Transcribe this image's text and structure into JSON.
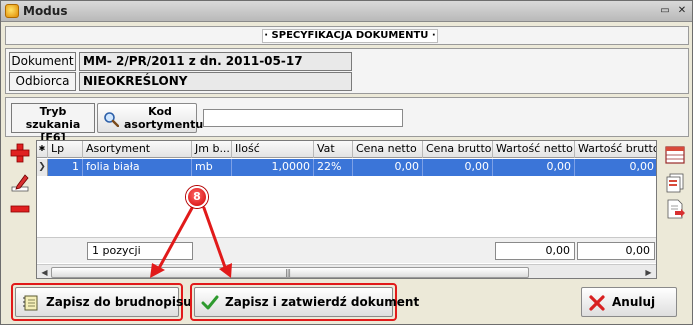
{
  "window": {
    "title": "Modus"
  },
  "section_title": "· SPECYFIKACJA DOKUMENTU ·",
  "document": {
    "label": "Dokument",
    "value": "MM- 2/PR/2011 z dn. 2011-05-17",
    "recipient_label": "Odbiorca",
    "recipient_value": "NIEOKREŚLONY"
  },
  "search": {
    "mode_line1": "Tryb szukania",
    "mode_line2": "[F6]",
    "code_button_line1": "Kod",
    "code_button_line2": "asortymentu",
    "input_value": ""
  },
  "grid": {
    "columns": [
      "Lp",
      "Asortyment",
      "Jm b...",
      "Ilość",
      "Vat",
      "Cena netto",
      "Cena brutto",
      "Wartość netto",
      "Wartość brutto"
    ],
    "rows": [
      {
        "lp": "1",
        "asortyment": "folia biała",
        "jm": "mb",
        "ilosc": "1,0000",
        "vat": "22%",
        "cena_netto": "0,00",
        "cena_brutto": "0,00",
        "wartosc_netto": "0,00",
        "wartosc_brutto": "0,00"
      }
    ],
    "footer": {
      "count": "1 pozycji",
      "sum_netto": "0,00",
      "sum_brutto": "0,00"
    }
  },
  "buttons": {
    "draft": "Zapisz do brudnopisu",
    "save_confirm": "Zapisz i zatwierdź dokument",
    "cancel": "Anuluj"
  },
  "annotation": {
    "badge": "8",
    "color": "#e11a1a"
  }
}
